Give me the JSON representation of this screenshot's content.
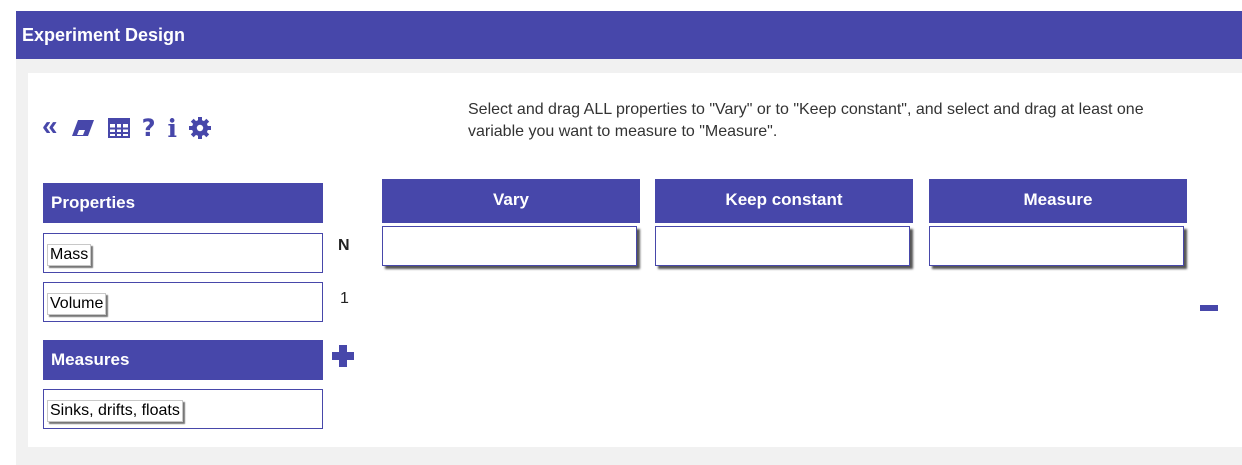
{
  "window": {
    "title": "Experiment Design"
  },
  "toolbar": {
    "icons": [
      "double-chevron-left-icon",
      "eraser-icon",
      "table-icon",
      "question-icon",
      "info-icon",
      "gear-icon"
    ],
    "glyphs": {
      "collapse": "«",
      "help": "?",
      "info": "i"
    }
  },
  "instructions": "Select and drag ALL properties to \"Vary\" or to \"Keep constant\", and select and drag at least one variable you want to measure to \"Measure\".",
  "properties": {
    "header": "Properties",
    "items": [
      "Mass",
      "Volume"
    ]
  },
  "measures": {
    "header": "Measures",
    "items": [
      "Sinks, drifts, floats"
    ]
  },
  "design": {
    "columns": [
      "Vary",
      "Keep constant",
      "Measure"
    ],
    "row_header": "N",
    "rows": [
      {
        "n": "1"
      }
    ]
  },
  "colors": {
    "accent": "#4747aa",
    "background": "#f1f1f1"
  }
}
